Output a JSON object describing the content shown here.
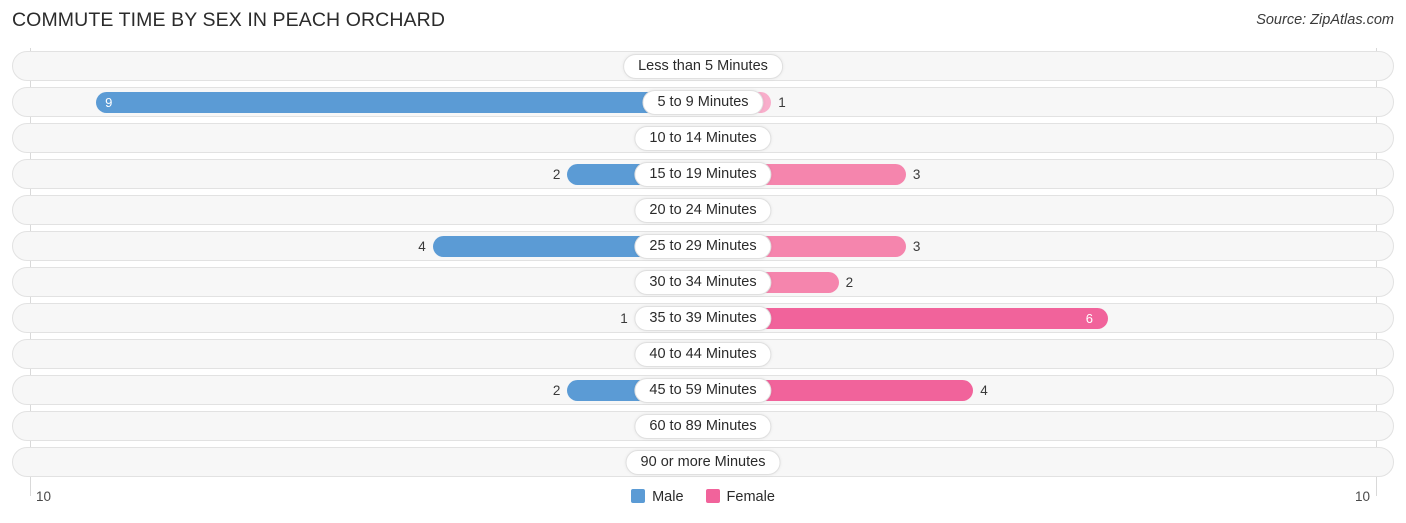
{
  "header": {
    "title": "COMMUTE TIME BY SEX IN PEACH ORCHARD",
    "source": "Source: ZipAtlas.com"
  },
  "axis": {
    "left_label": "10",
    "right_label": "10"
  },
  "legend": {
    "male_label": "Male",
    "female_label": "Female",
    "male_color": "#5b9bd5",
    "female_color": "#f1639b"
  },
  "chart_data": {
    "type": "bar",
    "title": "COMMUTE TIME BY SEX IN PEACH ORCHARD",
    "subtitle": "Source: ZipAtlas.com",
    "orientation": "horizontal-diverging",
    "xlabel": "",
    "ylabel": "",
    "xlim": [
      10,
      10
    ],
    "grid": false,
    "legend_position": "bottom-center",
    "categories": [
      "Less than 5 Minutes",
      "5 to 9 Minutes",
      "10 to 14 Minutes",
      "15 to 19 Minutes",
      "20 to 24 Minutes",
      "25 to 29 Minutes",
      "30 to 34 Minutes",
      "35 to 39 Minutes",
      "40 to 44 Minutes",
      "45 to 59 Minutes",
      "60 to 89 Minutes",
      "90 or more Minutes"
    ],
    "series": [
      {
        "name": "Male",
        "values": [
          0,
          9,
          0,
          2,
          0,
          4,
          0,
          1,
          0,
          2,
          0,
          0
        ]
      },
      {
        "name": "Female",
        "values": [
          0,
          1,
          0,
          3,
          0,
          3,
          2,
          6,
          0,
          4,
          0,
          0
        ]
      }
    ]
  },
  "rows": [
    {
      "category": "Less than 5 Minutes",
      "male": "0",
      "female": "0"
    },
    {
      "category": "5 to 9 Minutes",
      "male": "9",
      "female": "1"
    },
    {
      "category": "10 to 14 Minutes",
      "male": "0",
      "female": "0"
    },
    {
      "category": "15 to 19 Minutes",
      "male": "2",
      "female": "3"
    },
    {
      "category": "20 to 24 Minutes",
      "male": "0",
      "female": "0"
    },
    {
      "category": "25 to 29 Minutes",
      "male": "4",
      "female": "3"
    },
    {
      "category": "30 to 34 Minutes",
      "male": "0",
      "female": "2"
    },
    {
      "category": "35 to 39 Minutes",
      "male": "1",
      "female": "6"
    },
    {
      "category": "40 to 44 Minutes",
      "male": "0",
      "female": "0"
    },
    {
      "category": "45 to 59 Minutes",
      "male": "2",
      "female": "4"
    },
    {
      "category": "60 to 89 Minutes",
      "male": "0",
      "female": "0"
    },
    {
      "category": "90 or more Minutes",
      "male": "0",
      "female": "0"
    }
  ]
}
